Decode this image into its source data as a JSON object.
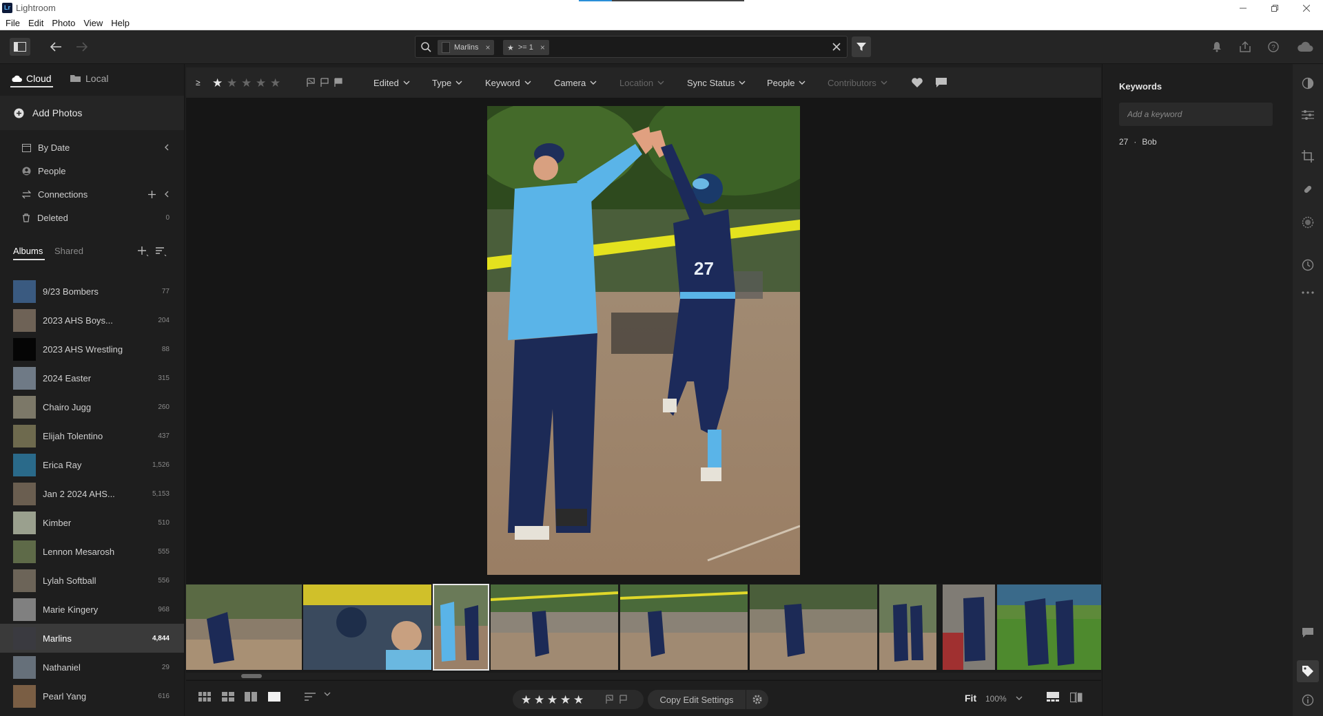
{
  "window": {
    "title": "Lightroom",
    "logo_text": "Lr"
  },
  "menu": [
    "File",
    "Edit",
    "Photo",
    "View",
    "Help"
  ],
  "search": {
    "chips": [
      {
        "label": "Marlins"
      },
      {
        "label": ">= 1"
      }
    ]
  },
  "sources": {
    "cloud": "Cloud",
    "local": "Local",
    "active": "Cloud"
  },
  "add_photos": "Add Photos",
  "nav": [
    {
      "label": "By Date",
      "icon": "calendar-icon"
    },
    {
      "label": "People",
      "icon": "person-icon"
    },
    {
      "label": "Connections",
      "icon": "connections-icon"
    },
    {
      "label": "Deleted",
      "icon": "trash-icon",
      "count": "0"
    }
  ],
  "album_tabs": {
    "albums": "Albums",
    "shared": "Shared",
    "active": "Albums"
  },
  "albums": [
    {
      "name": "9/23 Bombers",
      "count": "77",
      "color": "#3a5a80"
    },
    {
      "name": "2023 AHS Boys...",
      "count": "204",
      "color": "#6e6256"
    },
    {
      "name": "2023 AHS Wrestling",
      "count": "88",
      "color": "#050505"
    },
    {
      "name": "2024 Easter",
      "count": "315",
      "color": "#6f7a86"
    },
    {
      "name": "Chairo Jugg",
      "count": "260",
      "color": "#7c7868"
    },
    {
      "name": "Elijah Tolentino",
      "count": "437",
      "color": "#6e6a4e"
    },
    {
      "name": "Erica Ray",
      "count": "1,526",
      "color": "#2a6a8a"
    },
    {
      "name": "Jan 2 2024 AHS...",
      "count": "5,153",
      "color": "#6a5e50"
    },
    {
      "name": "Kimber",
      "count": "510",
      "color": "#9aa08e"
    },
    {
      "name": "Lennon Mesarosh",
      "count": "555",
      "color": "#5e6a48"
    },
    {
      "name": "Lylah Softball",
      "count": "556",
      "color": "#6c6458"
    },
    {
      "name": "Marie Kingery",
      "count": "968",
      "color": "#808080"
    },
    {
      "name": "Marlins",
      "count": "4,844",
      "color": "#3a3a40",
      "selected": true
    },
    {
      "name": "Nathaniel",
      "count": "29",
      "color": "#66707a"
    },
    {
      "name": "Pearl Yang",
      "count": "616",
      "color": "#7a5e44"
    }
  ],
  "filters": {
    "rating_op": "≥",
    "items": [
      {
        "label": "Edited",
        "enabled": true
      },
      {
        "label": "Type",
        "enabled": true
      },
      {
        "label": "Keyword",
        "enabled": true
      },
      {
        "label": "Camera",
        "enabled": true
      },
      {
        "label": "Location",
        "enabled": false
      },
      {
        "label": "Sync Status",
        "enabled": true
      },
      {
        "label": "People",
        "enabled": true
      },
      {
        "label": "Contributors",
        "enabled": false
      }
    ]
  },
  "bottom": {
    "copy_edit": "Copy Edit Settings",
    "fit": "Fit",
    "zoom": "100%"
  },
  "keywords": {
    "title": "Keywords",
    "placeholder": "Add a keyword",
    "items": [
      "27",
      "Bob"
    ],
    "separator": "·"
  },
  "colors": {
    "accent": "#2a8fd8",
    "panel": "#1e1e1e",
    "viewer": "#161616"
  }
}
